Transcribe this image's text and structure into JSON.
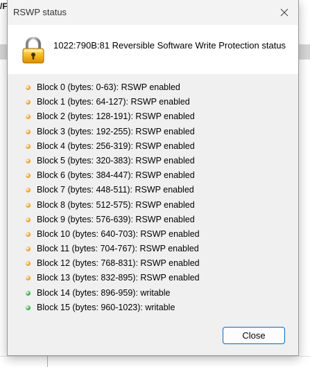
{
  "background": {
    "title_fragment": "/F"
  },
  "dialog": {
    "title": "RSWP status",
    "header_text": "1022:790B:81 Reversible Software Write Protection status",
    "close_button_label": "Close",
    "colors": {
      "enabled_dot": "#f0a030",
      "writable_dot": "#3cb04a",
      "button_border": "#0067c0"
    },
    "blocks": [
      {
        "text": "Block 0 (bytes: 0-63): RSWP enabled",
        "state": "enabled"
      },
      {
        "text": "Block 1 (bytes: 64-127): RSWP enabled",
        "state": "enabled"
      },
      {
        "text": "Block 2 (bytes: 128-191): RSWP enabled",
        "state": "enabled"
      },
      {
        "text": "Block 3 (bytes: 192-255): RSWP enabled",
        "state": "enabled"
      },
      {
        "text": "Block 4 (bytes: 256-319): RSWP enabled",
        "state": "enabled"
      },
      {
        "text": "Block 5 (bytes: 320-383): RSWP enabled",
        "state": "enabled"
      },
      {
        "text": "Block 6 (bytes: 384-447): RSWP enabled",
        "state": "enabled"
      },
      {
        "text": "Block 7 (bytes: 448-511): RSWP enabled",
        "state": "enabled"
      },
      {
        "text": "Block 8 (bytes: 512-575): RSWP enabled",
        "state": "enabled"
      },
      {
        "text": "Block 9 (bytes: 576-639): RSWP enabled",
        "state": "enabled"
      },
      {
        "text": "Block 10 (bytes: 640-703): RSWP enabled",
        "state": "enabled"
      },
      {
        "text": "Block 11 (bytes: 704-767): RSWP enabled",
        "state": "enabled"
      },
      {
        "text": "Block 12 (bytes: 768-831): RSWP enabled",
        "state": "enabled"
      },
      {
        "text": "Block 13 (bytes: 832-895): RSWP enabled",
        "state": "enabled"
      },
      {
        "text": "Block 14 (bytes: 896-959): writable",
        "state": "writable"
      },
      {
        "text": "Block 15 (bytes: 960-1023): writable",
        "state": "writable"
      }
    ],
    "icons": {
      "header": "padlock-icon",
      "close": "close-icon"
    }
  }
}
